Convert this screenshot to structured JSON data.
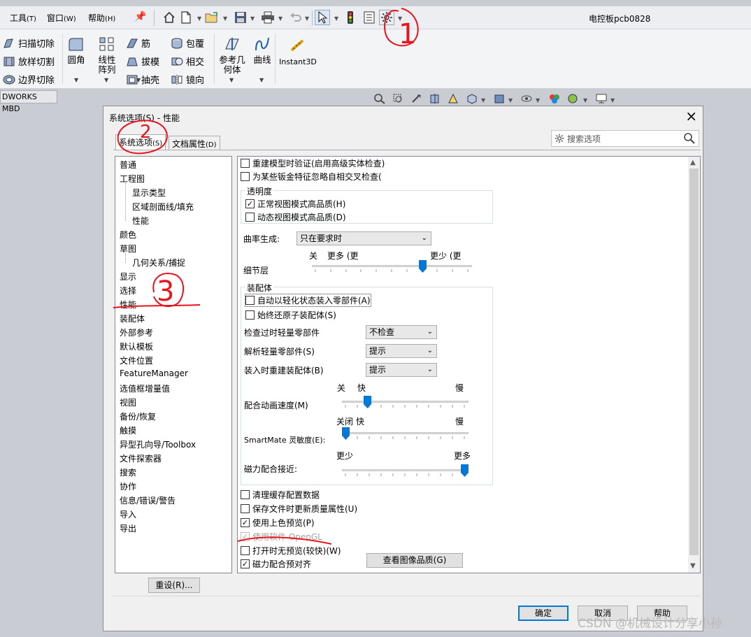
{
  "menubar": {
    "items": [
      {
        "label": "工具",
        "accel": "(T)"
      },
      {
        "label": "窗口",
        "accel": "(W)"
      },
      {
        "label": "帮助",
        "accel": "(H)"
      }
    ],
    "window_title": "电控板pcb0828"
  },
  "ribbon": {
    "small_buttons": [
      "扫描切除",
      "放样切割",
      "边界切除",
      "筋",
      "拔模",
      "抽壳",
      "包覆",
      "相交",
      "镜向"
    ],
    "big_buttons": [
      "圆角",
      "线性阵列",
      "参考几何体",
      "曲线",
      "Instant3D"
    ]
  },
  "tabs_row": {
    "mbd_tab": "DWORKS MBD"
  },
  "dialog": {
    "title": "系统选项(S) - 性能",
    "close": "×",
    "tabs": [
      {
        "label": "系统选项",
        "accel": "(S)"
      },
      {
        "label": "文档属性",
        "accel": "(D)"
      }
    ],
    "search_placeholder": "搜索选项",
    "tree": [
      "普通",
      "工程图",
      "显示类型",
      "区域剖面线/填充",
      "性能",
      "颜色",
      "草图",
      "几何关系/捕捉",
      "显示",
      "选择",
      "性能",
      "装配体",
      "外部参考",
      "默认模板",
      "文件位置",
      "FeatureManager",
      "选值框增量值",
      "视图",
      "备份/恢复",
      "触摸",
      "异型孔向导/Toolbox",
      "文件探索器",
      "搜索",
      "协作",
      "信息/错误/警告",
      "导入",
      "导出"
    ],
    "reset_button": "重设(R)...",
    "content": {
      "rebuild_verify": {
        "label": "重建模型时验证(启用高级实体检查)",
        "checked": false
      },
      "ignore_sheetmetal": {
        "label": "为某些钣金特征忽略自相交叉检查(",
        "checked": false
      },
      "transparency": {
        "title": "透明度",
        "normal_hq": {
          "label": "正常视图模式高品质(H)",
          "checked": true
        },
        "dynamic_hq": {
          "label": "动态视图模式高品质(D)",
          "checked": false
        }
      },
      "curvature": {
        "label": "曲率生成:",
        "value": "只在要求时"
      },
      "detail": {
        "label": "细节层",
        "left_label": "关",
        "mid_label": "更多 (更",
        "right_label": "更少 (更",
        "level": 0.7
      },
      "assemblies": {
        "title": "装配体",
        "auto_lightweight": {
          "label": "自动以轻化状态装入零部件(A)",
          "checked": false
        },
        "always_resolve": {
          "label": "始终还原子装配体(S)",
          "checked": false
        },
        "check_outdated": {
          "label": "检查过时轻量零部件",
          "value": "不检查"
        },
        "resolve_lightweight": {
          "label": "解析轻量零部件(S)",
          "value": "提示"
        },
        "rebuild_on_load": {
          "label": "装入时重建装配体(B)",
          "value": "提示"
        },
        "mate_anim": {
          "label": "配合动画速度(M)",
          "left_label": "关",
          "fast_label": "快",
          "slow_label": "慢",
          "level": 0.18
        },
        "smartmate": {
          "label": "SmartMate 灵敏度(E):",
          "left_label": "关闭",
          "fast_label": "快",
          "slow_label": "慢",
          "level": 0.0
        },
        "magnetic": {
          "label": "磁力配合接近:",
          "left_label": "更少",
          "right_label": "更多",
          "level": 1.0
        }
      },
      "purge_cache": {
        "label": "清理缓存配置数据",
        "checked": false
      },
      "update_mass": {
        "label": "保存文件时更新质量属性(U)",
        "checked": false
      },
      "shaded_preview": {
        "label": "使用上色预览(P)",
        "checked": true
      },
      "software_opengl": {
        "label": "使用软件 OpenGL",
        "checked": true,
        "disabled": true
      },
      "no_preview": {
        "label": "打开时无预览(较快)(W)",
        "checked": false
      },
      "magnetic_prealign": {
        "label": "磁力配合预对齐",
        "checked": true
      },
      "image_quality_button": "查看图像品质(G)"
    },
    "buttons": {
      "ok": "确定",
      "cancel": "取消",
      "help": "帮助"
    }
  },
  "annotations": [
    "1",
    "2",
    "3"
  ],
  "watermark": "CSDN @机械设计分享小孙",
  "colors": {
    "accent": "#0078d7",
    "annotation": "#e8141d"
  }
}
